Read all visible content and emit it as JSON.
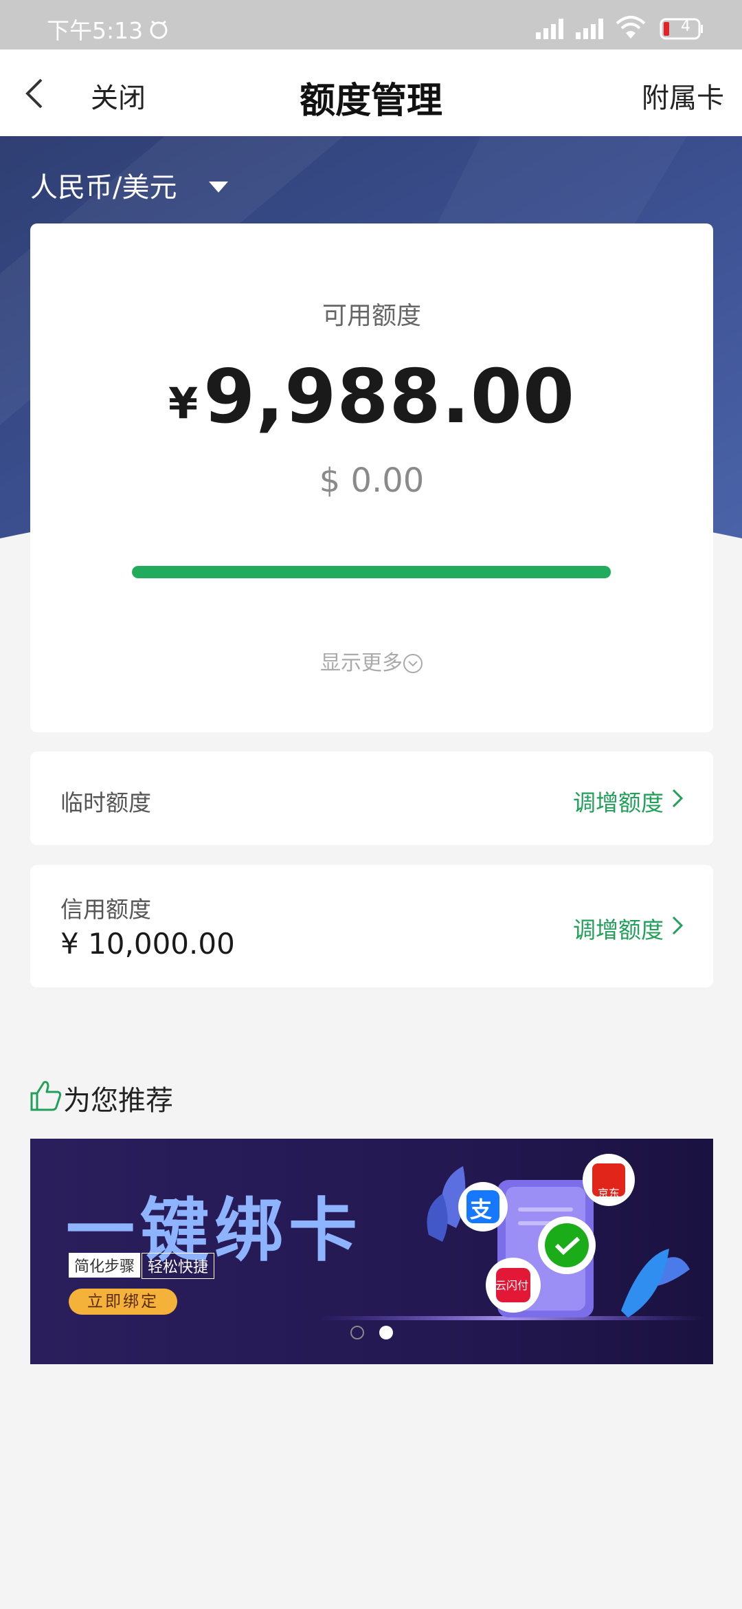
{
  "status_bar": {
    "time": "下午5:13",
    "battery": "4"
  },
  "nav": {
    "close": "关闭",
    "title": "额度管理",
    "right": "附属卡"
  },
  "currency": {
    "selected": "人民币/美元"
  },
  "available": {
    "label": "可用额度",
    "currency_symbol": "¥",
    "amount": "9,988.00",
    "usd": "$ 0.00",
    "progress_fraction": 0.9988,
    "show_more": "显示更多"
  },
  "temporary": {
    "label": "临时额度",
    "action": "调增额度"
  },
  "credit": {
    "label": "信用额度",
    "value": "¥ 10,000.00",
    "action": "调增额度"
  },
  "recommend": {
    "title": "为您推荐"
  },
  "banner": {
    "headline": "一键绑卡",
    "tag1": "简化步骤",
    "tag2": "轻松快捷",
    "button": "立即绑定",
    "jd_label": "京东",
    "alipay_label": "支",
    "unionpay_label": "云闪付"
  },
  "colors": {
    "accent_green": "#21a05a",
    "hero_blue": "#3b4f8f"
  }
}
